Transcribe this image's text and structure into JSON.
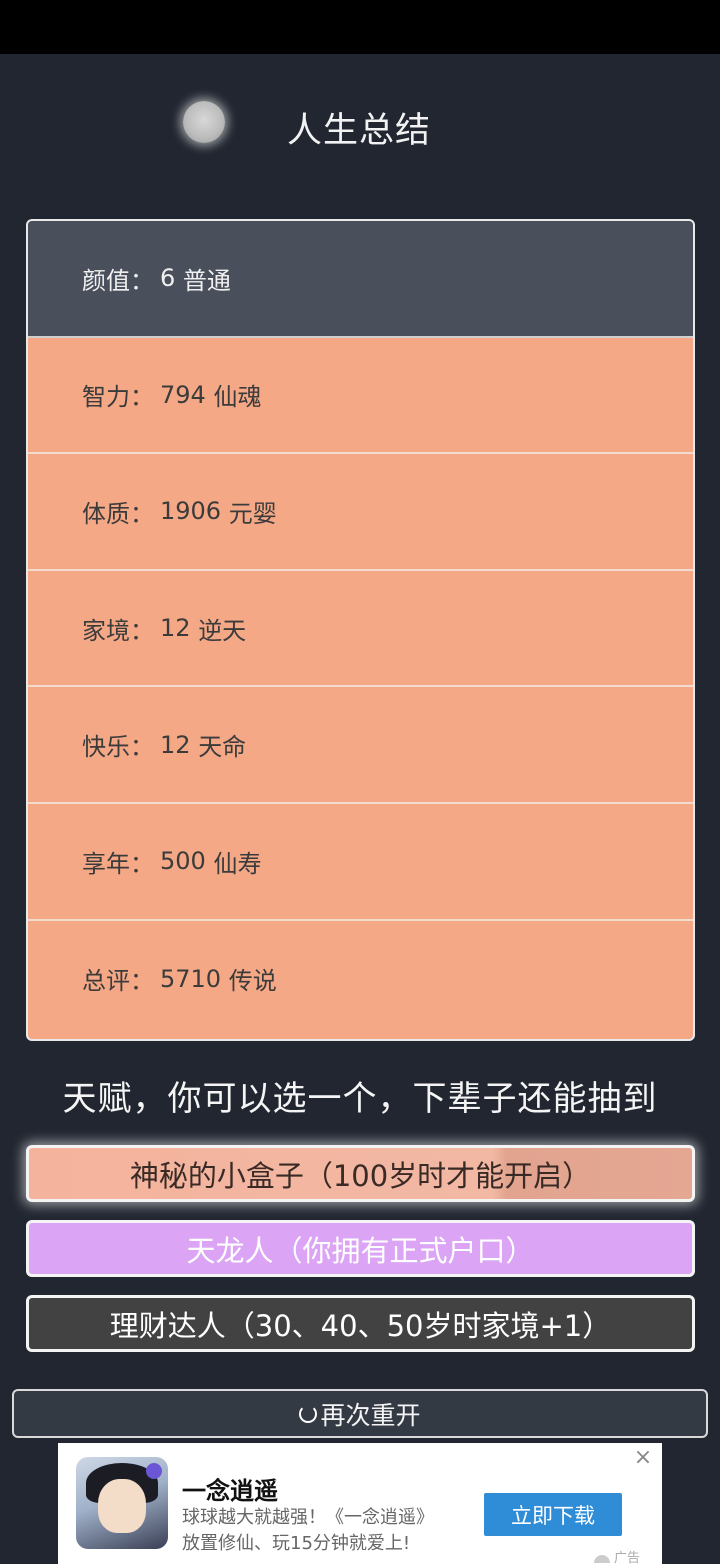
{
  "header": {
    "title": "人生总结"
  },
  "stats": [
    {
      "label": "颜值",
      "value": "6",
      "rank": "普通"
    },
    {
      "label": "智力",
      "value": "794",
      "rank": "仙魂"
    },
    {
      "label": "体质",
      "value": "1906",
      "rank": "元婴"
    },
    {
      "label": "家境",
      "value": "12",
      "rank": "逆天"
    },
    {
      "label": "快乐",
      "value": "12",
      "rank": "天命"
    },
    {
      "label": "享年",
      "value": "500",
      "rank": "仙寿"
    },
    {
      "label": "总评",
      "value": "5710",
      "rank": "传说"
    }
  ],
  "stat_separator": "：",
  "talent_heading": "天赋，你可以选一个，下辈子还能抽到",
  "talents": [
    {
      "label": "神秘的小盒子（100岁时才能开启）",
      "color": "#f4b39c"
    },
    {
      "label": "天龙人（你拥有正式户口）",
      "color": "#dba4f4"
    },
    {
      "label": "理财达人（30、40、50岁时家境+1）",
      "color": "#424242"
    }
  ],
  "restart_label": "再次重开",
  "ad": {
    "title": "一念逍遥",
    "desc_line1": "球球越大就越强！《一念逍遥》",
    "desc_line2": "放置修仙、玩15分钟就爱上!",
    "button": "立即下载",
    "close": "×",
    "label": "广告"
  }
}
